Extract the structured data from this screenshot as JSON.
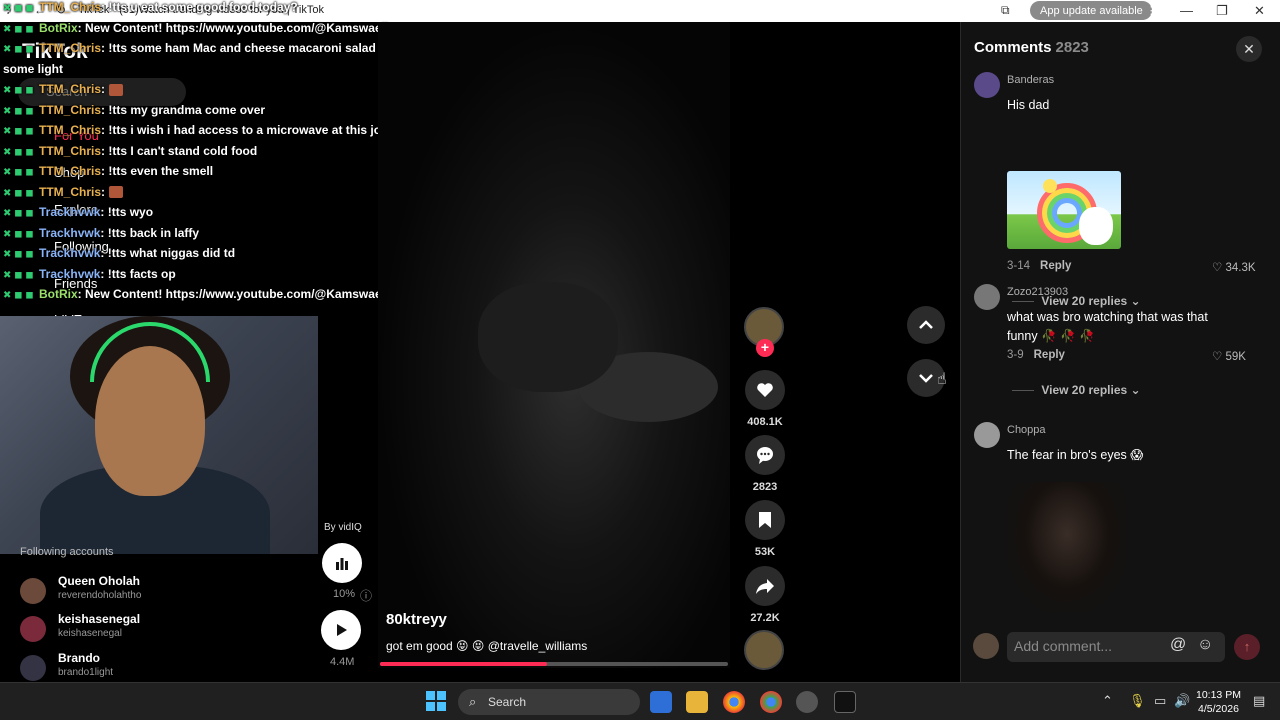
{
  "browser": {
    "tab_title": "TikTok - (61)Watch trending videos for you | TikTok",
    "app_update": "App update available"
  },
  "sidebar": {
    "logo": "TikTok",
    "search_placeholder": "Search",
    "items": [
      "For You",
      "Shop",
      "Explore",
      "Following",
      "Friends",
      "LIVE"
    ],
    "following_title": "Following accounts",
    "accounts": [
      {
        "name": "Queen Oholah",
        "handle": "reverendoholahtho"
      },
      {
        "name": "keishasenegal",
        "handle": "keishasenegal"
      },
      {
        "name": "Brando",
        "handle": "brando1light"
      }
    ]
  },
  "chat": [
    {
      "user": "TTM_Chris",
      "type": "normal",
      "msg": ": !tts u eat some good food today?"
    },
    {
      "user": "BotRix",
      "type": "bot",
      "msg": ": New Content! https://www.youtube.com/@Kamswaelive"
    },
    {
      "user": "TTM_Chris",
      "type": "normal",
      "msg": ": !tts some ham Mac and cheese macaroni salad and rice"
    },
    {
      "user": "",
      "type": "cont",
      "msg": "some light"
    },
    {
      "user": "TTM_Chris",
      "type": "normal",
      "msg": ":",
      "emote": true
    },
    {
      "user": "TTM_Chris",
      "type": "normal",
      "msg": ": !tts my grandma come over"
    },
    {
      "user": "TTM_Chris",
      "type": "normal",
      "msg": ": !tts i wish i had access to a microwave at this job"
    },
    {
      "user": "TTM_Chris",
      "type": "normal",
      "msg": ": !tts I can't stand cold food"
    },
    {
      "user": "TTM_Chris",
      "type": "normal",
      "msg": ": !tts even the smell"
    },
    {
      "user": "TTM_Chris",
      "type": "normal",
      "msg": ":",
      "emote": true
    },
    {
      "user": "Trackhvwk",
      "type": "track",
      "msg": ": !tts wyo"
    },
    {
      "user": "Trackhvwk",
      "type": "track",
      "msg": ": !tts back in laffy"
    },
    {
      "user": "Trackhvwk",
      "type": "track",
      "msg": ": !tts what niggas did td"
    },
    {
      "user": "Trackhvwk",
      "type": "track",
      "msg": ": !tts facts op"
    },
    {
      "user": "BotRix",
      "type": "bot",
      "msg": ": New Content! https://www.youtube.com/@Kamswaelive"
    }
  ],
  "vidiq": {
    "by": "By vidIQ",
    "percent": "10%",
    "views": "4.4M"
  },
  "video": {
    "author": "80ktreyy",
    "caption": "got em good 😝 😝 @travelle_williams",
    "progress": 0.48,
    "likes": "408.1K",
    "comments": "2823",
    "saves": "53K",
    "shares": "27.2K"
  },
  "comments_panel": {
    "title": "Comments",
    "count": "2823",
    "add_placeholder": "Add comment...",
    "items": [
      {
        "user": "Banderas",
        "text": "His dad",
        "date": "3-14",
        "reply": "Reply",
        "likes": "34.3K",
        "view_replies": "View 20 replies"
      },
      {
        "user": "Zozo213903",
        "text": "what was bro watching that was that funny 🥀 🥀 🥀",
        "date": "3-9",
        "reply": "Reply",
        "likes": "59K",
        "view_replies": "View 20 replies"
      },
      {
        "user": "Choppa",
        "text": "The fear in bro's eyes 😱"
      }
    ]
  },
  "taskbar": {
    "search": "Search",
    "time": "10:13 PM",
    "date": "4/5/2026"
  },
  "colors": {
    "accent": "#fe2c55",
    "panel": "#121212",
    "taskbar": "#202020"
  }
}
